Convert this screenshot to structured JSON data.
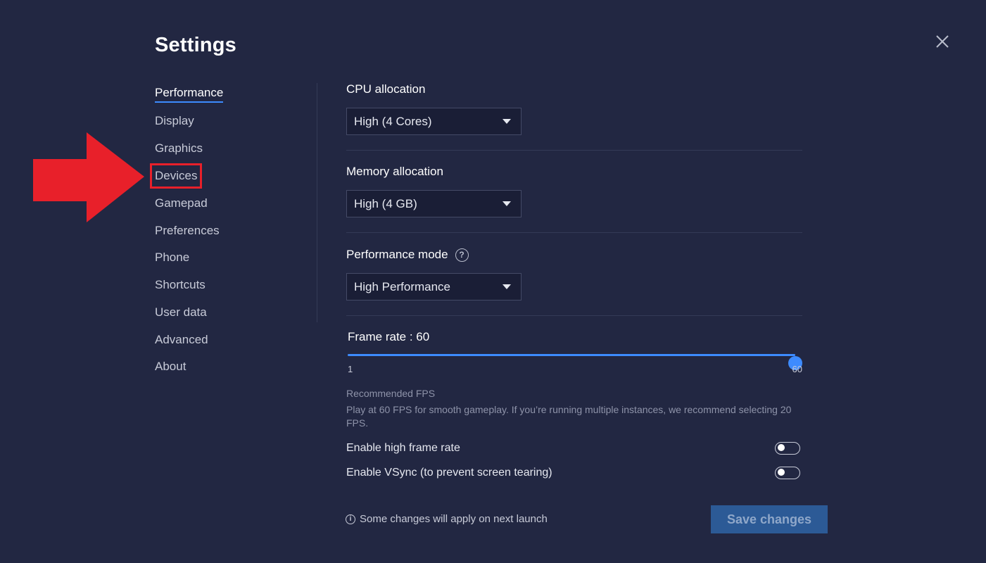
{
  "header": {
    "title": "Settings"
  },
  "sidebar": {
    "items": [
      {
        "label": "Performance"
      },
      {
        "label": "Display"
      },
      {
        "label": "Graphics"
      },
      {
        "label": "Devices"
      },
      {
        "label": "Gamepad"
      },
      {
        "label": "Preferences"
      },
      {
        "label": "Phone"
      },
      {
        "label": "Shortcuts"
      },
      {
        "label": "User data"
      },
      {
        "label": "Advanced"
      },
      {
        "label": "About"
      }
    ],
    "active": "Performance",
    "highlighted": "Devices"
  },
  "performance": {
    "cpu": {
      "label": "CPU allocation",
      "value": "High (4 Cores)"
    },
    "memory": {
      "label": "Memory allocation",
      "value": "High (4 GB)"
    },
    "mode": {
      "label": "Performance mode",
      "value": "High Performance",
      "help_glyph": "?"
    },
    "frame_rate": {
      "label": "Frame rate : 60",
      "value": 60,
      "min": 1,
      "max": 60,
      "min_label": "1",
      "max_label": "60"
    },
    "recommended": {
      "title": "Recommended FPS",
      "desc": "Play at 60 FPS for smooth gameplay. If you’re running multiple instances, we recommend selecting 20 FPS."
    },
    "toggles": {
      "high_frame_rate": {
        "label": "Enable high frame rate",
        "on": false
      },
      "vsync": {
        "label": "Enable VSync (to prevent screen tearing)",
        "on": false
      }
    }
  },
  "footer": {
    "info_glyph": "i",
    "note": "Some changes will apply on next launch",
    "save_label": "Save changes"
  },
  "colors": {
    "background": "#222742",
    "accent": "#3d8bff",
    "annotation_red": "#e8202a",
    "save_button": "#2c5a96"
  }
}
